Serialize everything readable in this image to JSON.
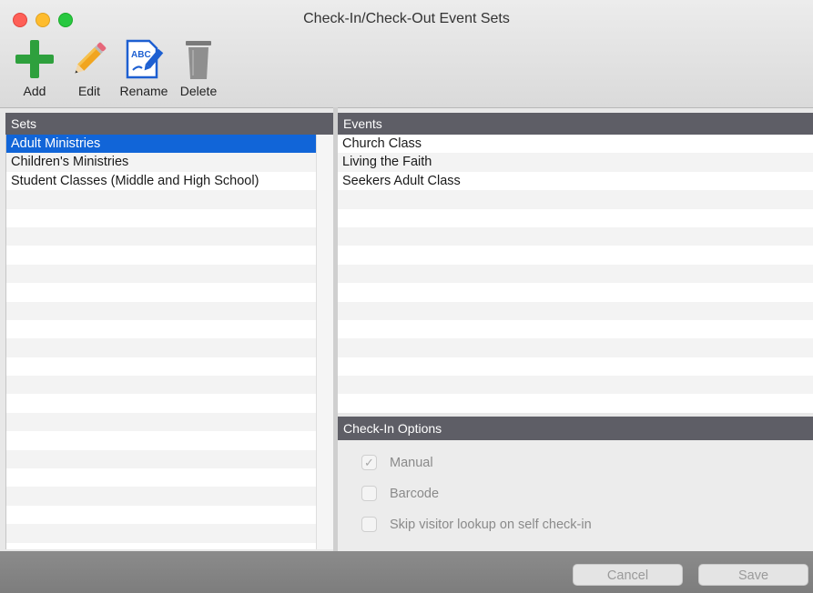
{
  "window": {
    "title": "Check-In/Check-Out Event Sets"
  },
  "toolbar": {
    "add_label": "Add",
    "edit_label": "Edit",
    "rename_label": "Rename",
    "delete_label": "Delete",
    "rename_icon_text": "ABC"
  },
  "sets": {
    "header": "Sets",
    "items": [
      "Adult Ministries",
      "Children's Ministries",
      "Student Classes (Middle and High School)"
    ],
    "selected_index": 0
  },
  "events": {
    "header": "Events",
    "items": [
      "Church Class",
      "Living the Faith",
      "Seekers Adult Class"
    ]
  },
  "options": {
    "header": "Check-In Options",
    "manual": {
      "label": "Manual",
      "checked": true
    },
    "barcode": {
      "label": "Barcode",
      "checked": false
    },
    "skip_lookup": {
      "label": "Skip visitor lookup on self check-in",
      "checked": false
    }
  },
  "footer": {
    "cancel_label": "Cancel",
    "save_label": "Save"
  },
  "colors": {
    "selection": "#1165d8",
    "header_bg": "#5e5e66",
    "add_green": "#2ea03d"
  }
}
